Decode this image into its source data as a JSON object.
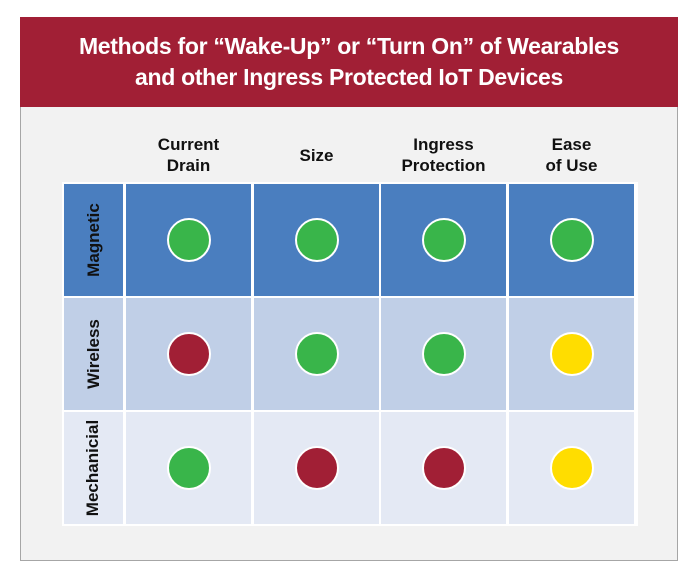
{
  "title": {
    "line1": "Methods for “Wake-Up” or “Turn On” of Wearables",
    "line2": "and other Ingress Protected IoT Devices"
  },
  "columns": [
    {
      "line1": "Current",
      "line2": "Drain"
    },
    {
      "line1": "Size",
      "line2": ""
    },
    {
      "line1": "Ingress",
      "line2": "Protection"
    },
    {
      "line1": "Ease",
      "line2": "of Use"
    }
  ],
  "rows": [
    {
      "label": "Magnetic",
      "background": "#4a7ebf",
      "ratings": [
        "green",
        "green",
        "green",
        "green"
      ]
    },
    {
      "label": "Wireless",
      "background": "#c0cfe7",
      "ratings": [
        "red",
        "green",
        "green",
        "yellow"
      ]
    },
    {
      "label": "Mechanicial",
      "background": "#e4e9f4",
      "ratings": [
        "green",
        "red",
        "red",
        "yellow"
      ]
    }
  ],
  "colors": {
    "green": "#39b54a",
    "red": "#a11f35",
    "yellow": "#ffdd00",
    "header": "#a11f35"
  }
}
